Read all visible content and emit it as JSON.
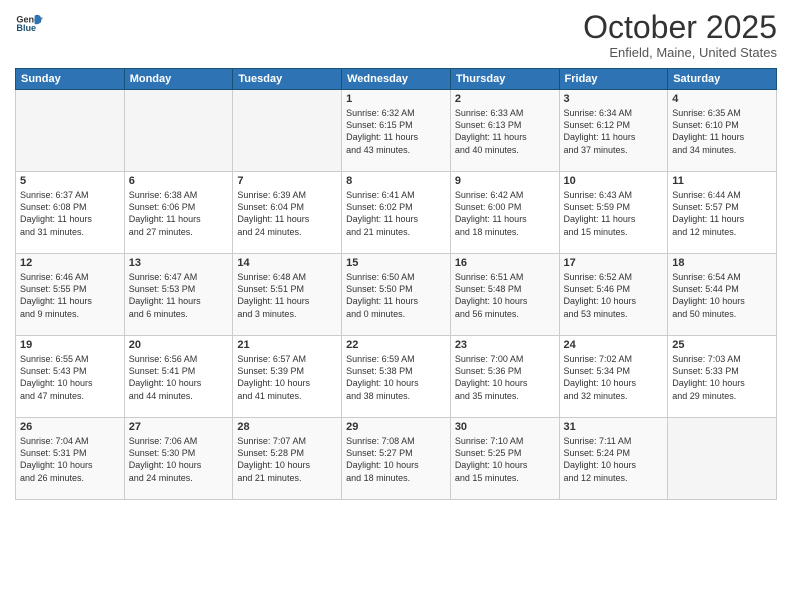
{
  "header": {
    "logo_general": "General",
    "logo_blue": "Blue",
    "month": "October 2025",
    "location": "Enfield, Maine, United States"
  },
  "days_of_week": [
    "Sunday",
    "Monday",
    "Tuesday",
    "Wednesday",
    "Thursday",
    "Friday",
    "Saturday"
  ],
  "weeks": [
    [
      {
        "day": "",
        "info": ""
      },
      {
        "day": "",
        "info": ""
      },
      {
        "day": "",
        "info": ""
      },
      {
        "day": "1",
        "info": "Sunrise: 6:32 AM\nSunset: 6:15 PM\nDaylight: 11 hours\nand 43 minutes."
      },
      {
        "day": "2",
        "info": "Sunrise: 6:33 AM\nSunset: 6:13 PM\nDaylight: 11 hours\nand 40 minutes."
      },
      {
        "day": "3",
        "info": "Sunrise: 6:34 AM\nSunset: 6:12 PM\nDaylight: 11 hours\nand 37 minutes."
      },
      {
        "day": "4",
        "info": "Sunrise: 6:35 AM\nSunset: 6:10 PM\nDaylight: 11 hours\nand 34 minutes."
      }
    ],
    [
      {
        "day": "5",
        "info": "Sunrise: 6:37 AM\nSunset: 6:08 PM\nDaylight: 11 hours\nand 31 minutes."
      },
      {
        "day": "6",
        "info": "Sunrise: 6:38 AM\nSunset: 6:06 PM\nDaylight: 11 hours\nand 27 minutes."
      },
      {
        "day": "7",
        "info": "Sunrise: 6:39 AM\nSunset: 6:04 PM\nDaylight: 11 hours\nand 24 minutes."
      },
      {
        "day": "8",
        "info": "Sunrise: 6:41 AM\nSunset: 6:02 PM\nDaylight: 11 hours\nand 21 minutes."
      },
      {
        "day": "9",
        "info": "Sunrise: 6:42 AM\nSunset: 6:00 PM\nDaylight: 11 hours\nand 18 minutes."
      },
      {
        "day": "10",
        "info": "Sunrise: 6:43 AM\nSunset: 5:59 PM\nDaylight: 11 hours\nand 15 minutes."
      },
      {
        "day": "11",
        "info": "Sunrise: 6:44 AM\nSunset: 5:57 PM\nDaylight: 11 hours\nand 12 minutes."
      }
    ],
    [
      {
        "day": "12",
        "info": "Sunrise: 6:46 AM\nSunset: 5:55 PM\nDaylight: 11 hours\nand 9 minutes."
      },
      {
        "day": "13",
        "info": "Sunrise: 6:47 AM\nSunset: 5:53 PM\nDaylight: 11 hours\nand 6 minutes."
      },
      {
        "day": "14",
        "info": "Sunrise: 6:48 AM\nSunset: 5:51 PM\nDaylight: 11 hours\nand 3 minutes."
      },
      {
        "day": "15",
        "info": "Sunrise: 6:50 AM\nSunset: 5:50 PM\nDaylight: 11 hours\nand 0 minutes."
      },
      {
        "day": "16",
        "info": "Sunrise: 6:51 AM\nSunset: 5:48 PM\nDaylight: 10 hours\nand 56 minutes."
      },
      {
        "day": "17",
        "info": "Sunrise: 6:52 AM\nSunset: 5:46 PM\nDaylight: 10 hours\nand 53 minutes."
      },
      {
        "day": "18",
        "info": "Sunrise: 6:54 AM\nSunset: 5:44 PM\nDaylight: 10 hours\nand 50 minutes."
      }
    ],
    [
      {
        "day": "19",
        "info": "Sunrise: 6:55 AM\nSunset: 5:43 PM\nDaylight: 10 hours\nand 47 minutes."
      },
      {
        "day": "20",
        "info": "Sunrise: 6:56 AM\nSunset: 5:41 PM\nDaylight: 10 hours\nand 44 minutes."
      },
      {
        "day": "21",
        "info": "Sunrise: 6:57 AM\nSunset: 5:39 PM\nDaylight: 10 hours\nand 41 minutes."
      },
      {
        "day": "22",
        "info": "Sunrise: 6:59 AM\nSunset: 5:38 PM\nDaylight: 10 hours\nand 38 minutes."
      },
      {
        "day": "23",
        "info": "Sunrise: 7:00 AM\nSunset: 5:36 PM\nDaylight: 10 hours\nand 35 minutes."
      },
      {
        "day": "24",
        "info": "Sunrise: 7:02 AM\nSunset: 5:34 PM\nDaylight: 10 hours\nand 32 minutes."
      },
      {
        "day": "25",
        "info": "Sunrise: 7:03 AM\nSunset: 5:33 PM\nDaylight: 10 hours\nand 29 minutes."
      }
    ],
    [
      {
        "day": "26",
        "info": "Sunrise: 7:04 AM\nSunset: 5:31 PM\nDaylight: 10 hours\nand 26 minutes."
      },
      {
        "day": "27",
        "info": "Sunrise: 7:06 AM\nSunset: 5:30 PM\nDaylight: 10 hours\nand 24 minutes."
      },
      {
        "day": "28",
        "info": "Sunrise: 7:07 AM\nSunset: 5:28 PM\nDaylight: 10 hours\nand 21 minutes."
      },
      {
        "day": "29",
        "info": "Sunrise: 7:08 AM\nSunset: 5:27 PM\nDaylight: 10 hours\nand 18 minutes."
      },
      {
        "day": "30",
        "info": "Sunrise: 7:10 AM\nSunset: 5:25 PM\nDaylight: 10 hours\nand 15 minutes."
      },
      {
        "day": "31",
        "info": "Sunrise: 7:11 AM\nSunset: 5:24 PM\nDaylight: 10 hours\nand 12 minutes."
      },
      {
        "day": "",
        "info": ""
      }
    ]
  ]
}
